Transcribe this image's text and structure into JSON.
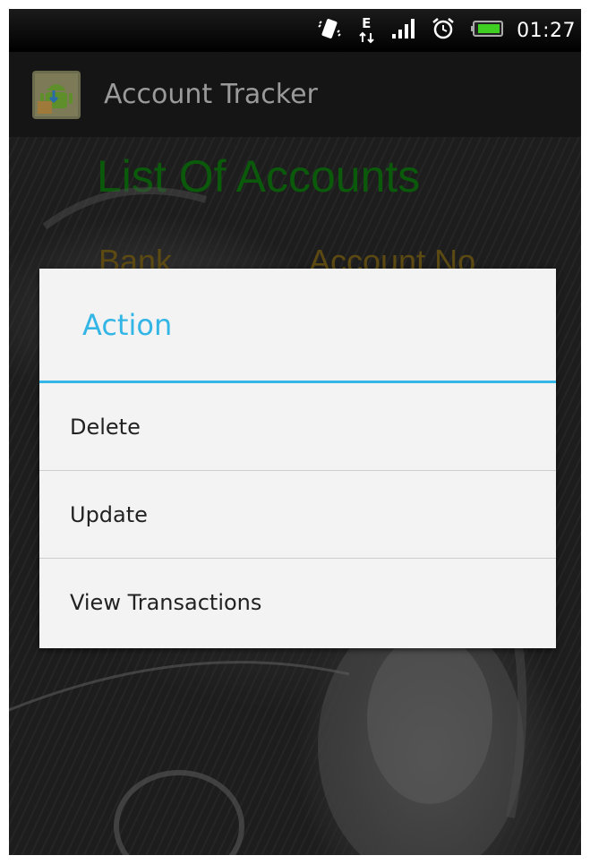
{
  "status_bar": {
    "time": "01:27",
    "icons": [
      "vibrate-icon",
      "data-edge-icon",
      "signal-icon",
      "alarm-icon",
      "battery-icon"
    ],
    "network_letter": "E"
  },
  "action_bar": {
    "app_title": "Account Tracker",
    "app_icon": "app-icon"
  },
  "background": {
    "list_title": "List Of Accounts",
    "columns": [
      "Bank",
      "Account No"
    ],
    "title_color": "#0b5a0b"
  },
  "dialog": {
    "title": "Action",
    "accent_color": "#33b5e5",
    "items": [
      {
        "label": "Delete"
      },
      {
        "label": "Update"
      },
      {
        "label": "View Transactions"
      }
    ]
  }
}
